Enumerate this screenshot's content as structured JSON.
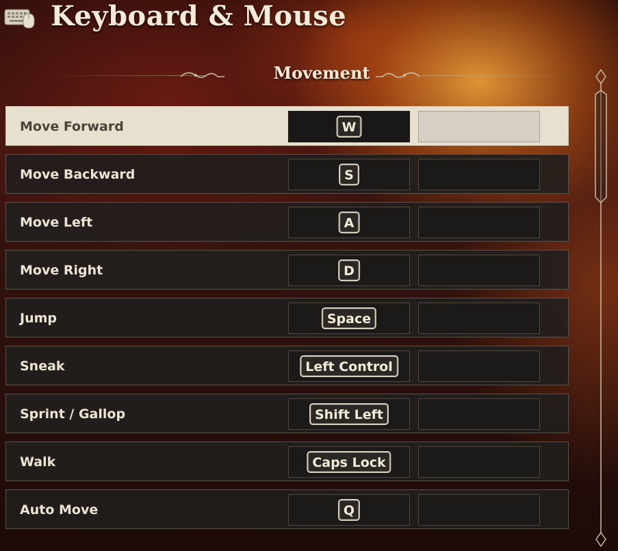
{
  "header": {
    "title": "Keyboard & Mouse",
    "icon": "keyboard-mouse-icon"
  },
  "section": {
    "title": "Movement"
  },
  "bindings": [
    {
      "action": "Move Forward",
      "primary": "W",
      "secondary": "",
      "selected": true
    },
    {
      "action": "Move Backward",
      "primary": "S",
      "secondary": "",
      "selected": false
    },
    {
      "action": "Move Left",
      "primary": "A",
      "secondary": "",
      "selected": false
    },
    {
      "action": "Move Right",
      "primary": "D",
      "secondary": "",
      "selected": false
    },
    {
      "action": "Jump",
      "primary": "Space",
      "secondary": "",
      "selected": false
    },
    {
      "action": "Sneak",
      "primary": "Left Control",
      "secondary": "",
      "selected": false
    },
    {
      "action": "Sprint / Gallop",
      "primary": "Shift Left",
      "secondary": "",
      "selected": false
    },
    {
      "action": "Walk",
      "primary": "Caps Lock",
      "secondary": "",
      "selected": false
    },
    {
      "action": "Auto Move",
      "primary": "Q",
      "secondary": "",
      "selected": false
    }
  ],
  "colors": {
    "text": "#f3ebd8",
    "row_bg": "#221e1c",
    "selected_bg": "#e8e0cf"
  }
}
